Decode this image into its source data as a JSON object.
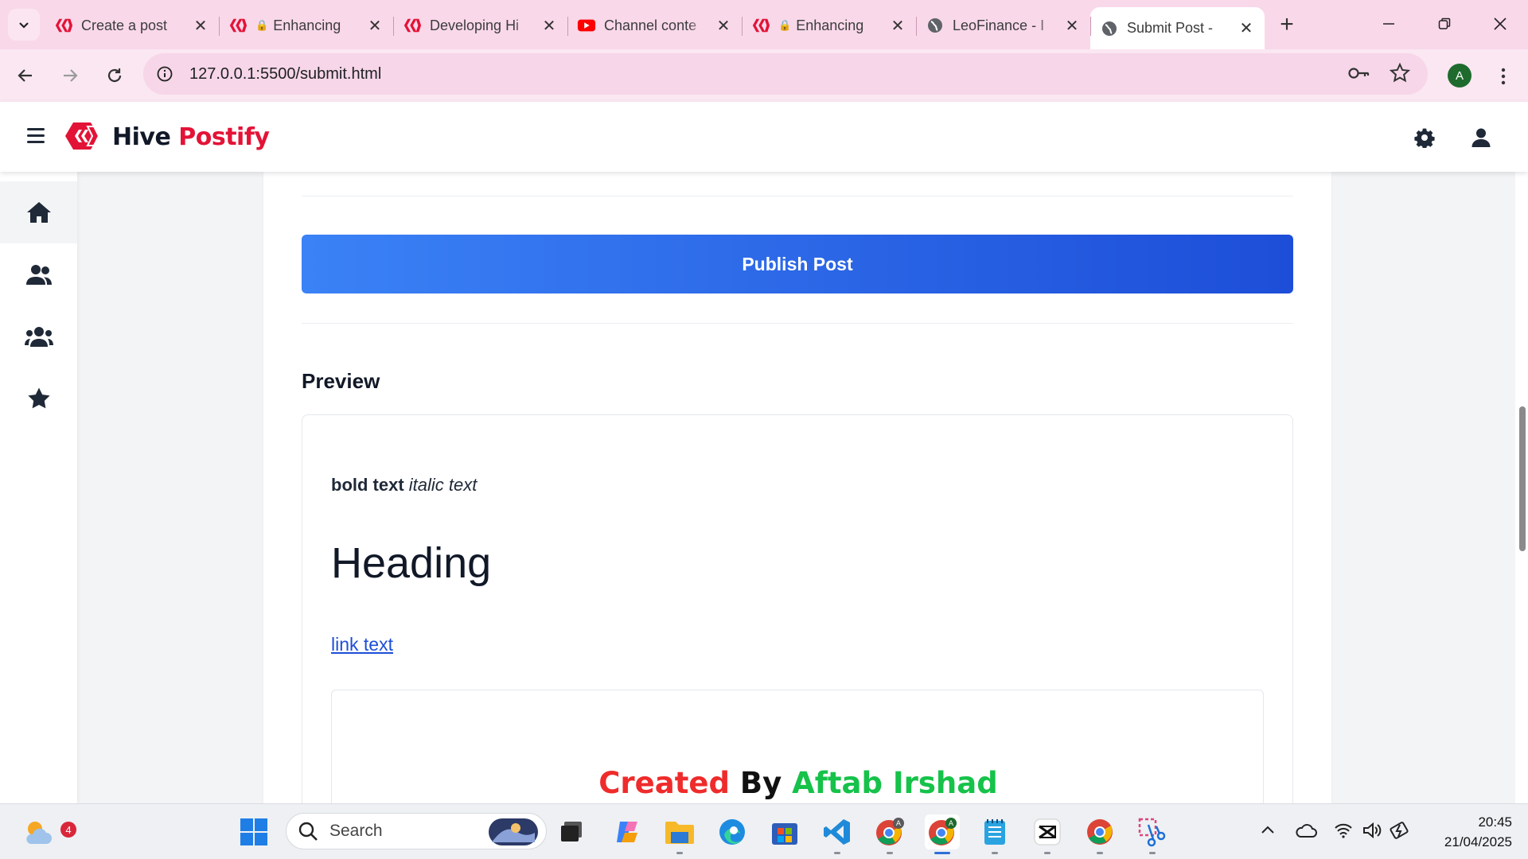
{
  "browser": {
    "tabs": [
      {
        "title": "Create a post",
        "icon": "hive-icon",
        "lock": false,
        "active": false
      },
      {
        "title": "Enhancing",
        "icon": "hive-icon",
        "lock": true,
        "active": false
      },
      {
        "title": "Developing Hi",
        "icon": "hive-icon",
        "lock": false,
        "active": false
      },
      {
        "title": "Channel conte",
        "icon": "youtube-icon",
        "lock": false,
        "active": false
      },
      {
        "title": "Enhancing",
        "icon": "hive-icon",
        "lock": true,
        "active": false
      },
      {
        "title": "LeoFinance - I",
        "icon": "globe-icon",
        "lock": false,
        "active": false
      },
      {
        "title": "Submit Post -",
        "icon": "globe-icon",
        "lock": false,
        "active": true
      }
    ],
    "url": "127.0.0.1:5500/submit.html",
    "profile_initial": "A"
  },
  "app": {
    "brand_part1": "Hive",
    "brand_part2": "Postify",
    "accent_color": "#e31337",
    "sidebar": [
      "home-icon",
      "users-icon",
      "group-icon",
      "star-icon"
    ]
  },
  "main": {
    "publish_label": "Publish Post",
    "preview_title": "Preview",
    "preview": {
      "bold": "bold text",
      "italic": "italic text",
      "heading": "Heading",
      "link": "link text"
    }
  },
  "overlay": {
    "part1": "Created",
    "part2": "By",
    "part3": "Aftab Irshad"
  },
  "taskbar": {
    "weather_badge": "4",
    "search_placeholder": "Search",
    "time": "20:45",
    "date": "21/04/2025"
  }
}
